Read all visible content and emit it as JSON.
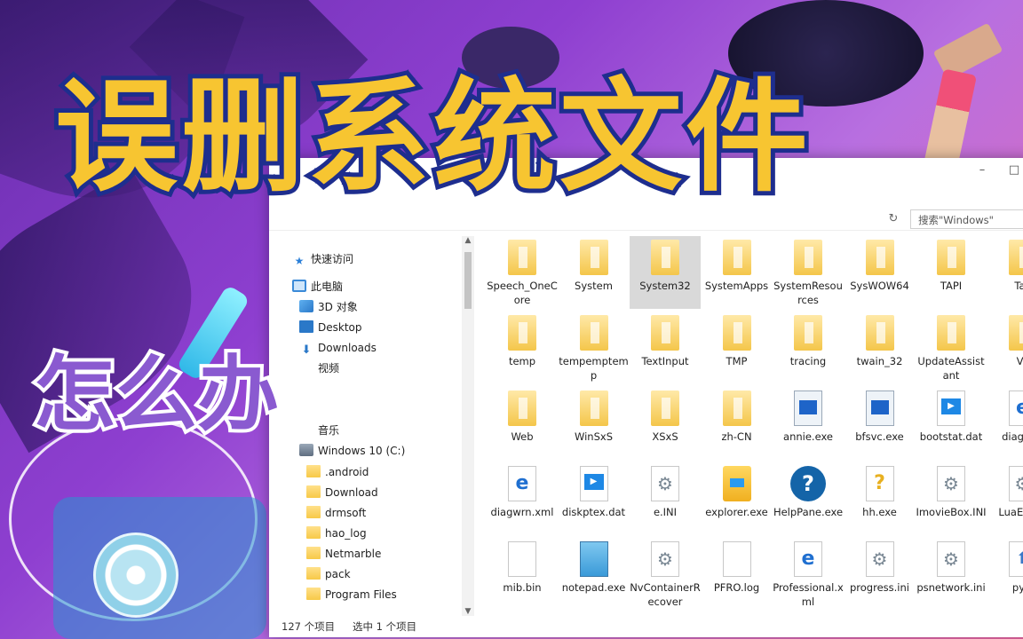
{
  "headline": "误删系统文件",
  "subhead": "怎么办",
  "window": {
    "minimize": "–",
    "maximize": "□",
    "search_placeholder": "搜索\"Windows\"",
    "refresh_icon": "↻"
  },
  "nav": {
    "quick_access": "快速访问",
    "this_pc": "此电脑",
    "objects_3d": "3D 对象",
    "desktop": "Desktop",
    "downloads": "Downloads",
    "videos": "视频",
    "music": "音乐",
    "drive": "Windows 10 (C:)",
    "folders": [
      "android",
      "Download",
      "drmsoft",
      "hao_log",
      "Netmarble",
      "pack",
      "Program Files"
    ]
  },
  "files": [
    {
      "name": "Speech_OneCore",
      "icon": "folder"
    },
    {
      "name": "System",
      "icon": "folder"
    },
    {
      "name": "System32",
      "icon": "folder",
      "selected": true
    },
    {
      "name": "SystemApps",
      "icon": "folder"
    },
    {
      "name": "SystemResources",
      "icon": "folder"
    },
    {
      "name": "SysWOW64",
      "icon": "folder"
    },
    {
      "name": "TAPI",
      "icon": "folder"
    },
    {
      "name": "Tas",
      "icon": "folder"
    },
    {
      "name": "temp",
      "icon": "folder"
    },
    {
      "name": "tempemptemp",
      "icon": "folder"
    },
    {
      "name": "TextInput",
      "icon": "folder"
    },
    {
      "name": "TMP",
      "icon": "folder"
    },
    {
      "name": "tracing",
      "icon": "folder"
    },
    {
      "name": "twain_32",
      "icon": "folder"
    },
    {
      "name": "UpdateAssistant",
      "icon": "folder"
    },
    {
      "name": "Vs",
      "icon": "folder"
    },
    {
      "name": "Web",
      "icon": "folder"
    },
    {
      "name": "WinSxS",
      "icon": "folder"
    },
    {
      "name": "XSxS",
      "icon": "folder"
    },
    {
      "name": "zh-CN",
      "icon": "folder"
    },
    {
      "name": "annie.exe",
      "icon": "exe"
    },
    {
      "name": "bfsvc.exe",
      "icon": "exe"
    },
    {
      "name": "bootstat.dat",
      "icon": "video"
    },
    {
      "name": "diage m",
      "icon": "edoc"
    },
    {
      "name": "diagwrn.xml",
      "icon": "edoc"
    },
    {
      "name": "diskptex.dat",
      "icon": "video"
    },
    {
      "name": "e.INI",
      "icon": "gear"
    },
    {
      "name": "explorer.exe",
      "icon": "explorer"
    },
    {
      "name": "HelpPane.exe",
      "icon": "help"
    },
    {
      "name": "hh.exe",
      "icon": "hh"
    },
    {
      "name": "ImovieBox.INI",
      "icon": "gear"
    },
    {
      "name": "LuaEd INI",
      "icon": "gear"
    },
    {
      "name": "mib.bin",
      "icon": "doc"
    },
    {
      "name": "notepad.exe",
      "icon": "notepad"
    },
    {
      "name": "NvContainerRecover",
      "icon": "gear"
    },
    {
      "name": "PFRO.log",
      "icon": "doc"
    },
    {
      "name": "Professional.xml",
      "icon": "edoc"
    },
    {
      "name": "progress.ini",
      "icon": "gear"
    },
    {
      "name": "psnetwork.ini",
      "icon": "gear"
    },
    {
      "name": "py.e",
      "icon": "py"
    }
  ],
  "status": {
    "count": "127 个项目",
    "selected": "选中 1 个项目"
  }
}
